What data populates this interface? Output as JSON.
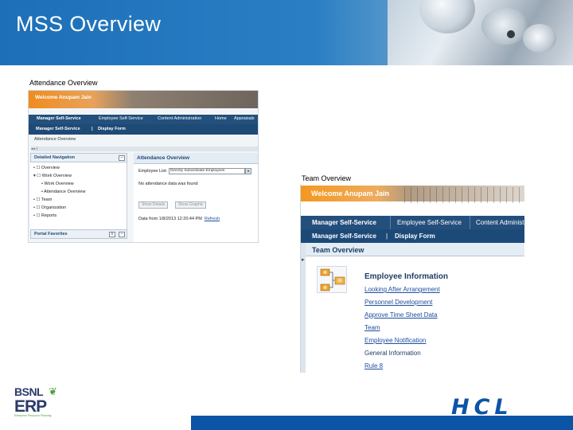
{
  "slide": {
    "title": "MSS Overview"
  },
  "captions": {
    "attendance": "Attendance Overview",
    "team": "Team Overview"
  },
  "attendance_screen": {
    "welcome": "Welcome Anupam Jain",
    "tabs": [
      "Manager Self-Service",
      "Employee Self-Service",
      "Content Administration",
      "Home",
      "Appraisals"
    ],
    "subnav": [
      "Manager Self-Service",
      "Display Form"
    ],
    "breadcrumb": "Attendance Overview",
    "detail_nav_title": "Detailed Navigation",
    "nav_items": [
      "Overview",
      "Work Overview",
      "Work Overview",
      "Attendance Overview",
      "Team",
      "Organization",
      "Reports"
    ],
    "portal_favorites": "Portal Favorites",
    "panel_title": "Attendance Overview",
    "employee_label": "Employee List:",
    "employee_select": "Directly Subordinate Employees",
    "no_data": "No attendance data was found",
    "show_details": "Show Details",
    "show_graphic": "Show Graphic",
    "data_from": "Data from 1/8/2013 12:20:44 PM",
    "refresh": "Refresh"
  },
  "team_screen": {
    "welcome": "Welcome Anupam Jain",
    "tabs": [
      "Manager Self-Service",
      "Employee Self-Service",
      "Content Administ"
    ],
    "subnav": [
      "Manager Self-Service",
      "Display Form"
    ],
    "panel_title": "Team Overview",
    "info_title": "Employee Information",
    "links": [
      "Looking After Arrangement",
      "Personnel Development",
      "Approve Time Sheet Data",
      "Team",
      "Employee Notification",
      "General Information",
      "Rule 8"
    ]
  },
  "footer": {
    "bsnl": "BSNL",
    "erp": "ERP",
    "erp_tagline": "Enterprise Resource Planning",
    "hcl": "HCL"
  },
  "colors": {
    "header_blue": "#1d6fb8",
    "nav_blue": "#244f7c",
    "welcome_orange": "#f08c1e",
    "hcl_blue": "#0c54a6"
  }
}
